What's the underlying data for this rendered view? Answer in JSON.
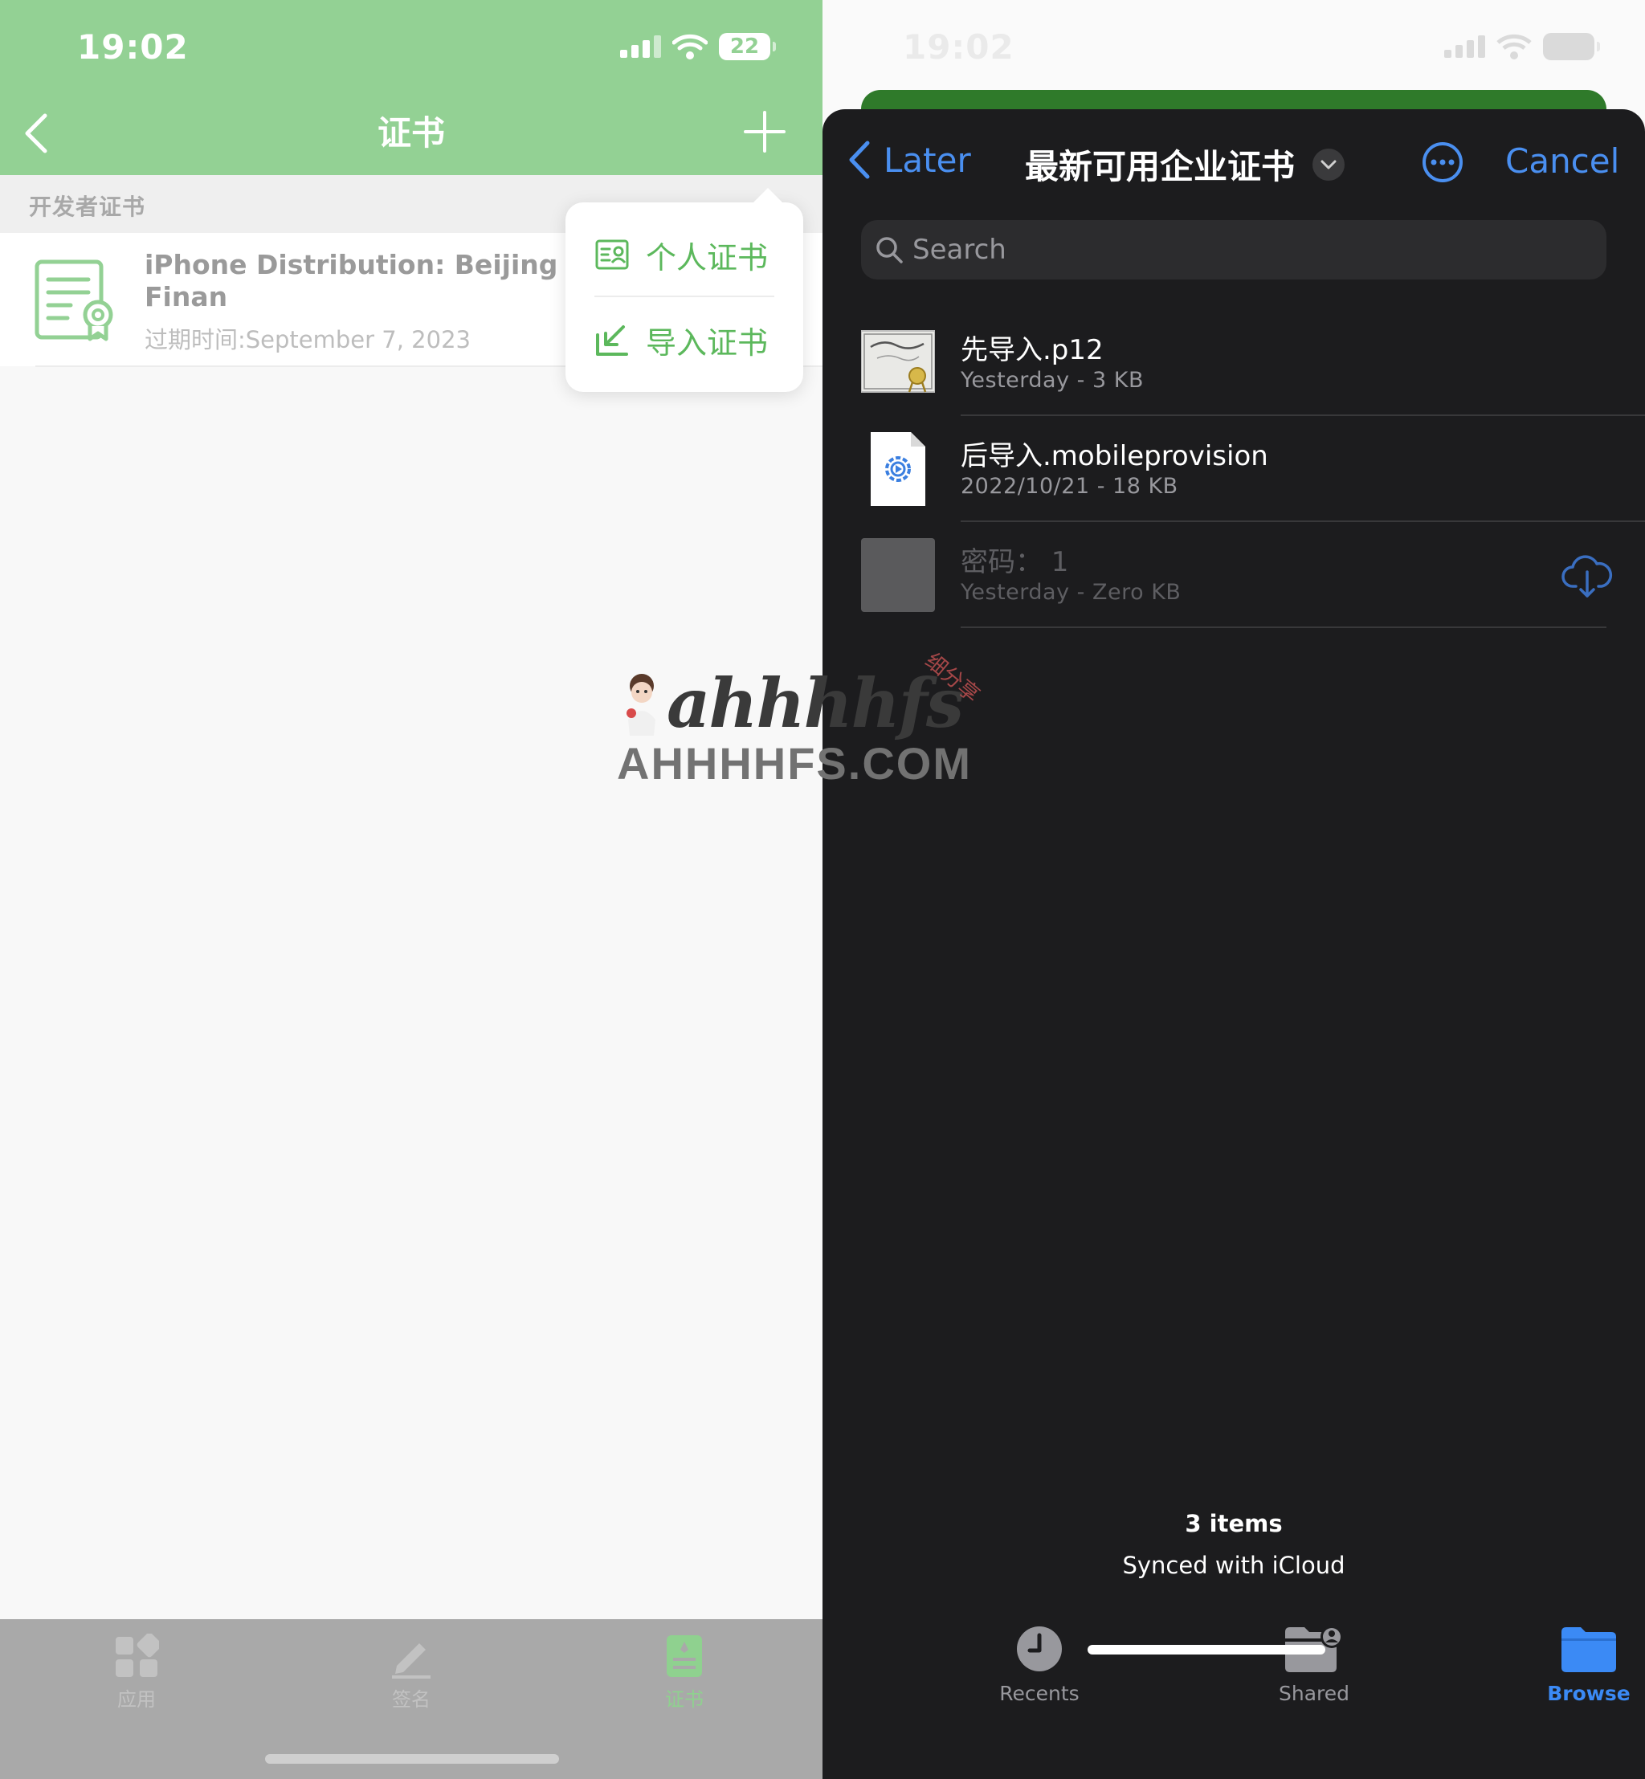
{
  "left": {
    "status_time": "19:02",
    "battery": "22",
    "nav_title": "证书",
    "section_title": "开发者证书",
    "cert": {
      "name": "iPhone Distribution: Beijing Finan\ntd",
      "expiry": "过期时间:September 7, 2023"
    },
    "popover": {
      "personal_cert": "个人证书",
      "import_cert": "导入证书"
    },
    "tabs": [
      {
        "label": "应用",
        "icon": "apps-grid-icon"
      },
      {
        "label": "签名",
        "icon": "pen-sign-icon"
      },
      {
        "label": "证书",
        "icon": "certificate-icon",
        "active": true
      }
    ],
    "colors": {
      "header": "#93d194",
      "accent": "#5cb85c"
    }
  },
  "right": {
    "status_time": "19:02",
    "back_label": "Later",
    "title": "最新可用企业证书",
    "cancel_label": "Cancel",
    "search_placeholder": "Search",
    "files": [
      {
        "name": "先导入.p12",
        "meta": "Yesterday - 3 KB",
        "icon": "certificate-file-icon"
      },
      {
        "name": "后导入.mobileprovision",
        "meta": "2022/10/21 - 18 KB",
        "icon": "provision-file-icon"
      },
      {
        "name": "密码： 1",
        "meta": "Yesterday - Zero KB",
        "icon": "placeholder-file-icon",
        "cloud": true
      }
    ],
    "footer_count": "3 items",
    "footer_sync": "Synced with iCloud",
    "tabs": [
      {
        "label": "Recents",
        "icon": "clock-icon"
      },
      {
        "label": "Shared",
        "icon": "shared-folder-icon"
      },
      {
        "label": "Browse",
        "icon": "folder-icon",
        "active": true
      }
    ],
    "colors": {
      "accent": "#4a8ff0",
      "sheet": "#1c1c1e"
    }
  },
  "watermark": {
    "logo": "ahhhhfs",
    "tag": "细分享",
    "url": "AHHHHFS.COM"
  }
}
